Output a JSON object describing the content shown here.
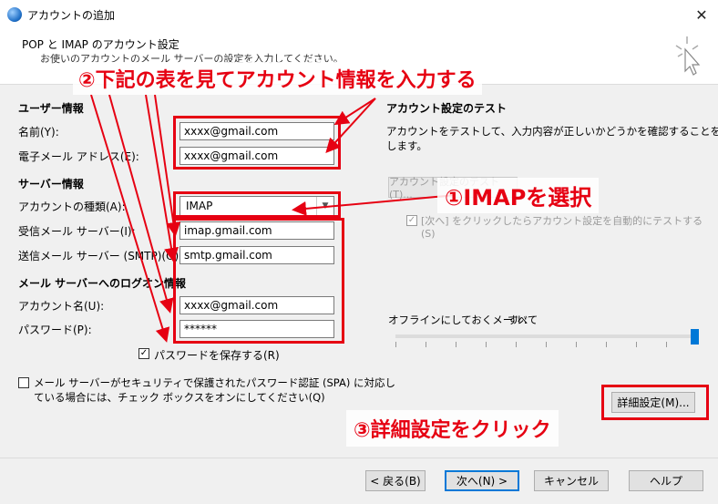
{
  "window": {
    "title": "アカウントの追加",
    "close_glyph": "✕"
  },
  "header": {
    "title": "POP と IMAP のアカウント設定",
    "subtitle": "お使いのアカウントのメール サーバーの設定を入力してください。"
  },
  "user_info": {
    "section": "ユーザー情報",
    "name_label": "名前(Y):",
    "name_value": "xxxx@gmail.com",
    "email_label": "電子メール アドレス(E):",
    "email_value": "xxxx@gmail.com"
  },
  "server_info": {
    "section": "サーバー情報",
    "account_type_label": "アカウントの種類(A):",
    "account_type_value": "IMAP",
    "incoming_label": "受信メール サーバー(I):",
    "incoming_value": "imap.gmail.com",
    "outgoing_label": "送信メール サーバー (SMTP)(O):",
    "outgoing_value": "smtp.gmail.com"
  },
  "logon_info": {
    "section": "メール サーバーへのログオン情報",
    "account_name_label": "アカウント名(U):",
    "account_name_value": "xxxx@gmail.com",
    "password_label": "パスワード(P):",
    "password_value": "******",
    "remember_password_label": "パスワードを保存する(R)",
    "spa_label_line1": "メール サーバーがセキュリティで保護されたパスワード認証 (SPA) に対応し",
    "spa_label_line2": "ている場合には、チェック ボックスをオンにしてください(Q)"
  },
  "test": {
    "section": "アカウント設定のテスト",
    "description_line1": "アカウントをテストして、入力内容が正しいかどうかを確認することをお勧め",
    "description_line2": "します。",
    "test_button_label": "アカウント設定のテスト(T)...",
    "auto_test_label_line1": "[次へ] をクリックしたらアカウント設定を自動的にテストする",
    "auto_test_label_line2": "(S)"
  },
  "offline": {
    "label": "オフラインにしておくメール:",
    "value": "すべて",
    "slider_level": 1.0
  },
  "advanced_button_label": "詳細設定(M)...",
  "footer": {
    "back": "< 戻る(B)",
    "next": "次へ(N) >",
    "cancel": "キャンセル",
    "help": "ヘルプ"
  },
  "annotations": {
    "step1": "①IMAPを選択",
    "step2": "②下記の表を見てアカウント情報を入力する",
    "step3": "③詳細設定をクリック",
    "color": "#e60012"
  }
}
